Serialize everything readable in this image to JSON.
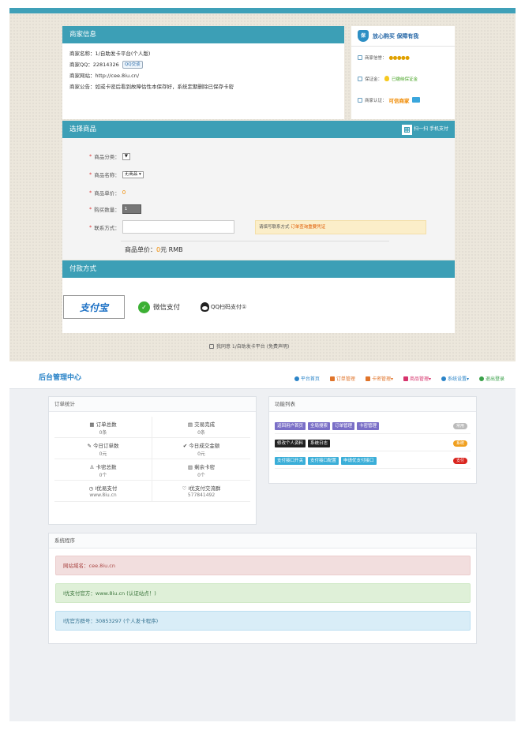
{
  "shop": {
    "merchant_panel_title": "商家信息",
    "merchant_lines": [
      "商家名称：1/自助发卡平台(个人版)",
      "商家网站：http://cee.8iu.cn/",
      "商家公告：如或卡密后看到故障估性本保存好，系统定期删除已保存卡密"
    ],
    "qq_label": "商家QQ：22814326",
    "qq_badge": "QQ交谈",
    "trust_title": "放心购买  保障有我",
    "shield_text": "保",
    "trust_rows": {
      "credit_label": "商家信誉：",
      "credit_coins": "●●●●●",
      "deposit_label": "保证金：",
      "deposit_value": "已缴纳保证金",
      "cert_label": "商家认证：",
      "cert_value": "可信商家"
    },
    "select_panel_title": "选择商品",
    "scan_pay": "扫一扫 手机支付",
    "form": {
      "category_label": "商品分类：",
      "category_value": "▼",
      "name_label": "商品名称：",
      "name_value": "无商品 ▾",
      "price_label": "商品单价：",
      "price_value": "0",
      "qty_label": "购买数量：",
      "qty_value": "1",
      "contact_label": "联系方式：",
      "contact_tip_prefix": "请填写联系方式 ",
      "contact_tip_highlight": "订单查询重要凭证"
    },
    "unit_price_prefix": "商品单价：",
    "unit_price_value": "0",
    "unit_price_suffix": "元 RMB",
    "pay_panel_title": "付款方式",
    "alipay_text": "支付宝",
    "wechat_text": "微信支付",
    "qq_pay_text": "QQ扫码支付①",
    "agree_text": "我同意 1/自助发卡平台 (免费声明)"
  },
  "admin": {
    "brand": "后台管理中心",
    "nav": [
      {
        "label": "平台首页",
        "color": "#2b84c8"
      },
      {
        "label": "订单管理",
        "color": "#e0742a"
      },
      {
        "label": "卡密管理▾",
        "color": "#e0742a"
      },
      {
        "label": "商品管理▾",
        "color": "#d6336c"
      },
      {
        "label": "系统设置▾",
        "color": "#2b84c8"
      },
      {
        "label": "退出登录",
        "color": "#3aa14a"
      }
    ],
    "order_box_title": "订单统计",
    "stats": [
      {
        "label": "订单总数",
        "value": "0条"
      },
      {
        "label": "交易完成",
        "value": "0条"
      },
      {
        "label": "今日订单数",
        "value": "0元"
      },
      {
        "label": "今日成交金额",
        "value": "0元"
      },
      {
        "label": "卡密总数",
        "value": "0个"
      },
      {
        "label": "剩余卡密",
        "value": "0个"
      },
      {
        "label": "I优易支付",
        "value": "www.8iu.cn"
      },
      {
        "label": "I优支付交流群",
        "value": "577841492"
      }
    ],
    "func_box_title": "功能列表",
    "func_rows": [
      {
        "buttons": [
          "返回用户首页",
          "全局搜索",
          "订单管理",
          "卡密管理"
        ],
        "btn_color": "purple",
        "tag": "常用",
        "tag_color": "#bbbbbb"
      },
      {
        "buttons": [
          "修改个人资料",
          "系统日志"
        ],
        "btn_color": "black",
        "tag": "系统",
        "tag_color": "#f0a020"
      },
      {
        "buttons": [
          "支付接口开关",
          "支付接口配置",
          "申请优支付接口"
        ],
        "btn_color": "cyan",
        "tag": "支付",
        "tag_color": "#d9231d"
      }
    ],
    "sys_box_title": "系统程序",
    "alerts": [
      {
        "text": "网站域名：cee.8iu.cn",
        "style": "red"
      },
      {
        "text": "I优支付官方：www.8iu.cn (认证站点！)",
        "style": "green"
      },
      {
        "text": "I优官方群号：30853297 (个人发卡程序)",
        "style": "blue"
      }
    ]
  }
}
